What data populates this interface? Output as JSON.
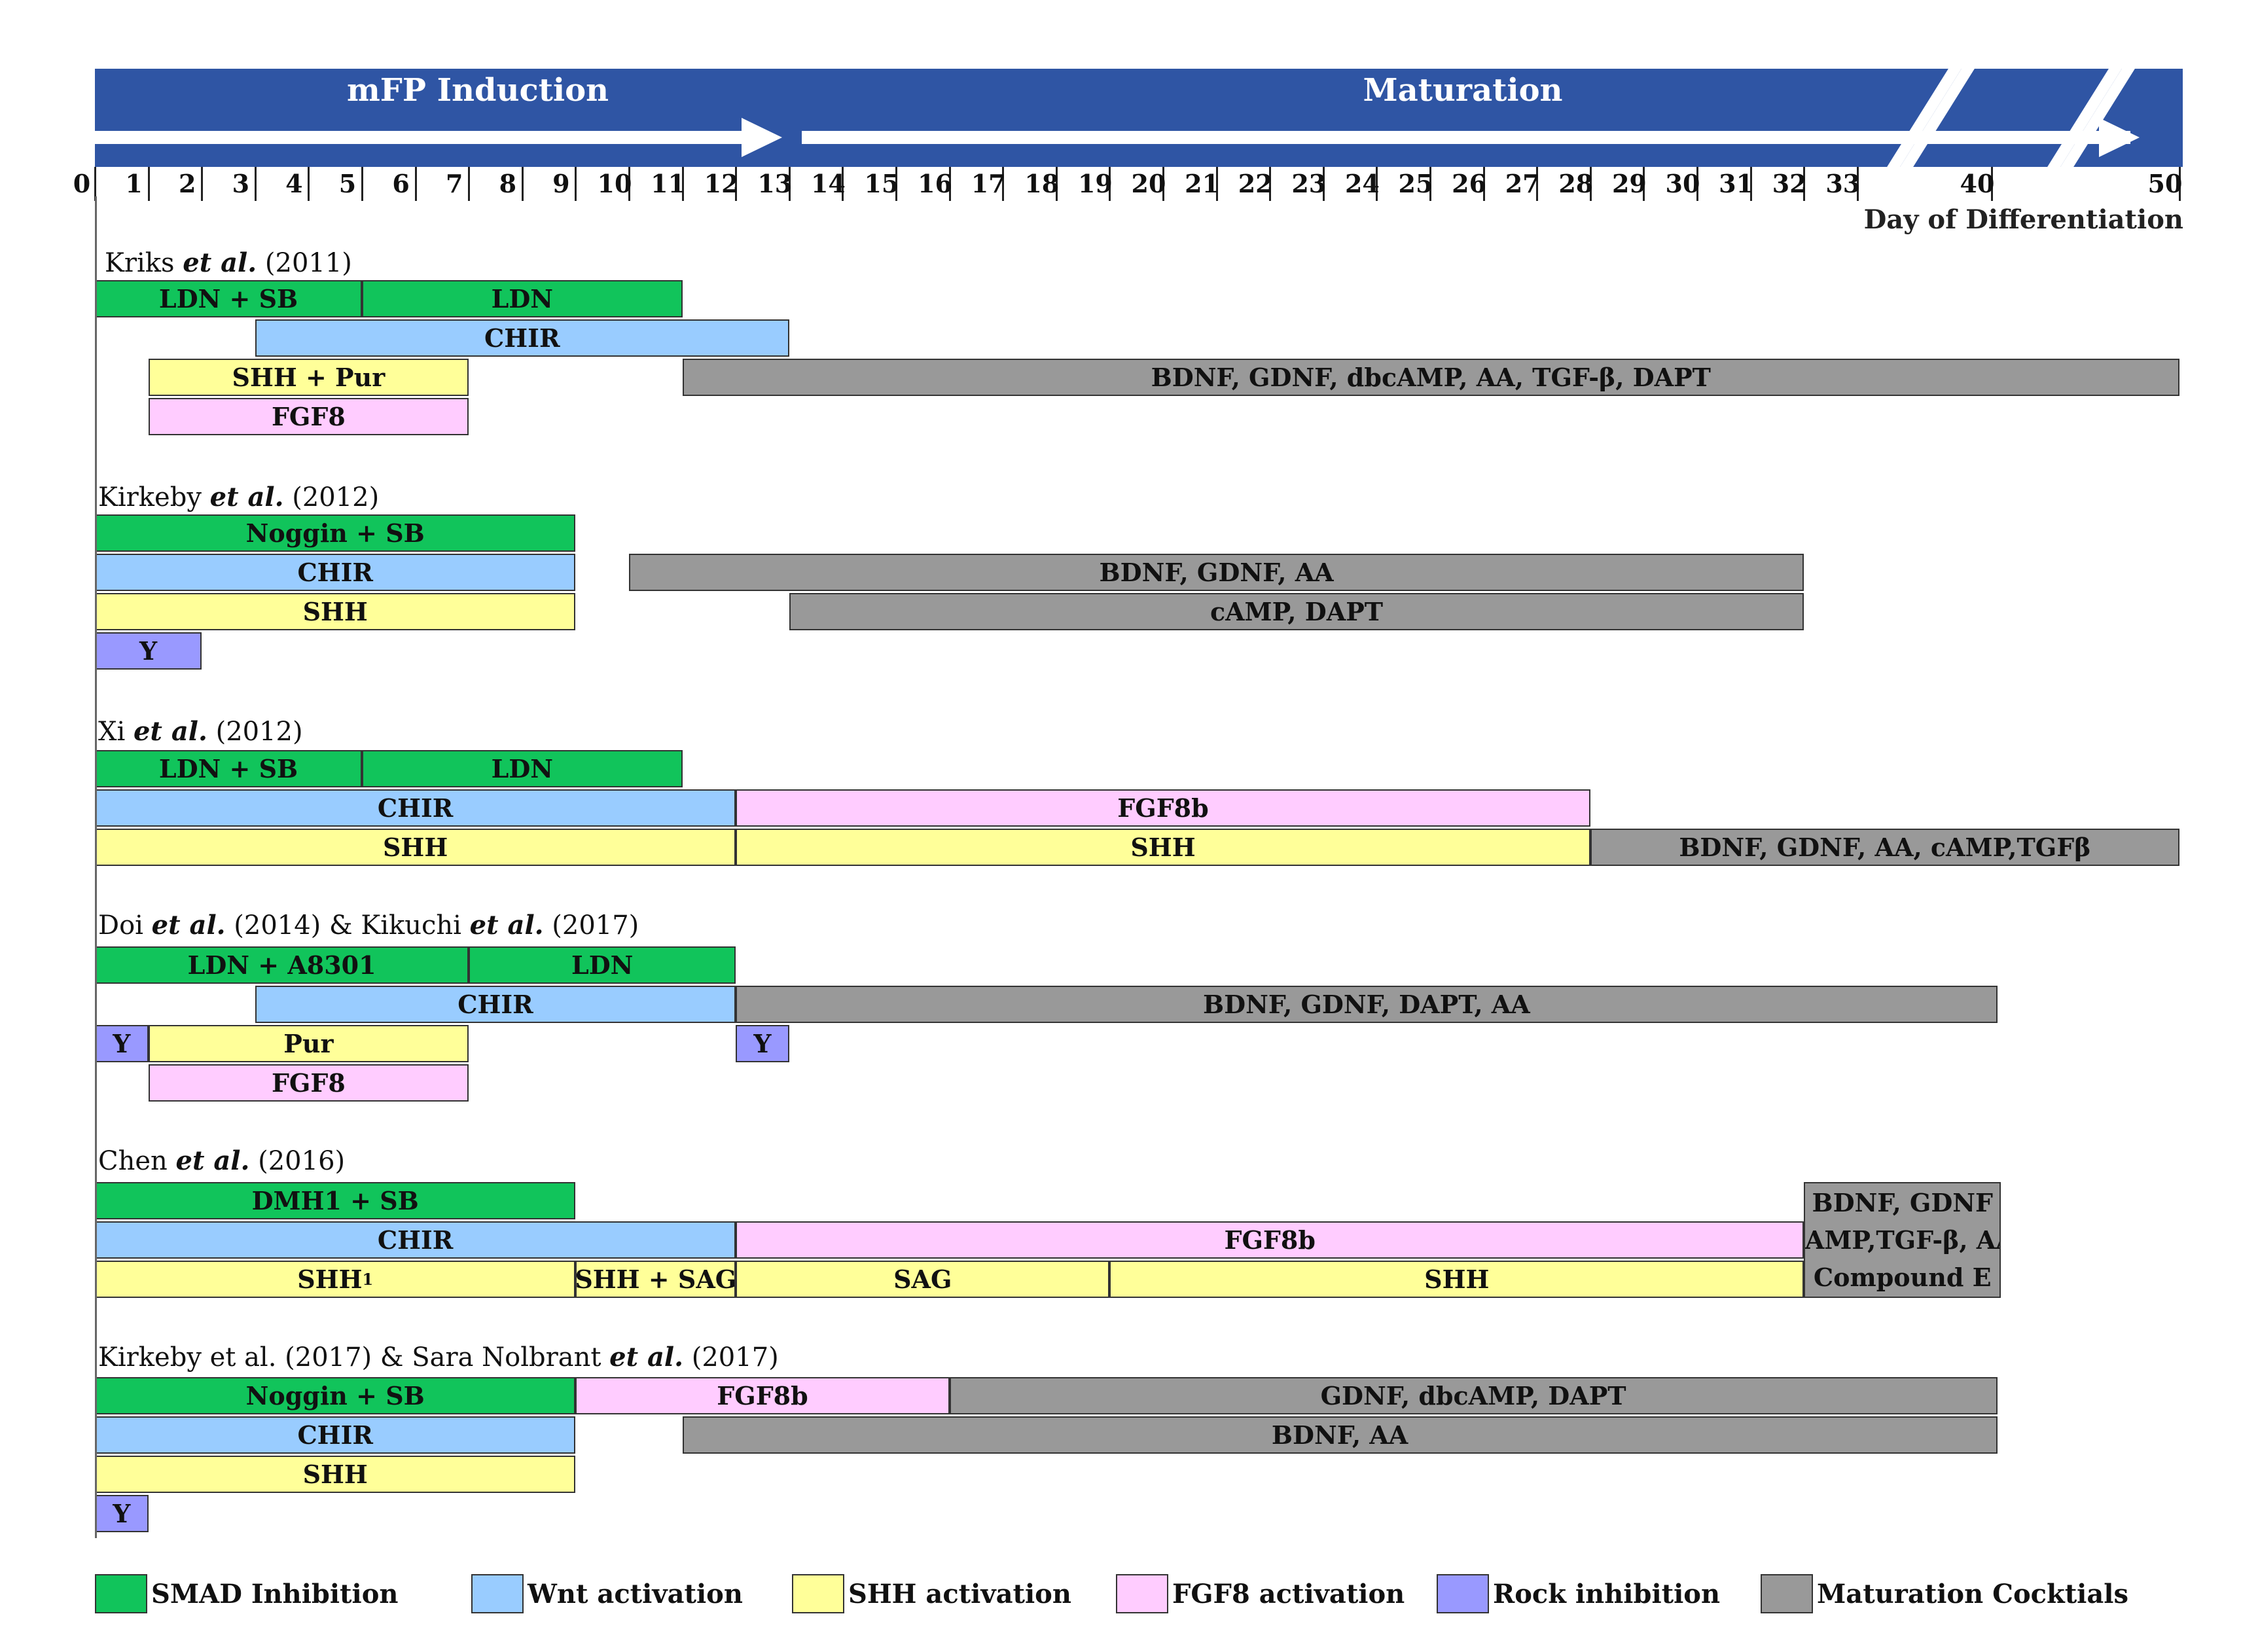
{
  "header": {
    "phases": [
      {
        "label": "mFP Induction",
        "from": 0,
        "to": 13
      },
      {
        "label": "Maturation",
        "from": 13,
        "to": 50
      }
    ],
    "axis_ticks": [
      "0",
      "1",
      "2",
      "3",
      "4",
      "5",
      "6",
      "7",
      "8",
      "9",
      "10",
      "11",
      "12",
      "13",
      "14",
      "15",
      "16",
      "17",
      "18",
      "19",
      "20",
      "21",
      "22",
      "23",
      "24",
      "25",
      "26",
      "27",
      "28",
      "29",
      "30",
      "31",
      "32",
      "33",
      "40",
      "50"
    ],
    "axis_title": "Day of Differentiation"
  },
  "colors": {
    "smad": "#11c45b",
    "wnt": "#99ccff",
    "shh": "#ffff99",
    "fgf8": "#ffccff",
    "rock": "#9999ff",
    "maturation": "#999999",
    "phase": "#2f55a4"
  },
  "studies": [
    {
      "title_parts": [
        {
          "t": "Kriks "
        },
        {
          "t": "et al.",
          "i": true
        },
        {
          "t": " (2011)"
        }
      ],
      "bars": [
        {
          "label": "LDN + SB",
          "row": 0,
          "from": 0,
          "to": 5,
          "type": "smad"
        },
        {
          "label": "LDN",
          "row": 0,
          "from": 5,
          "to": 11,
          "type": "smad"
        },
        {
          "label": "CHIR",
          "row": 1,
          "from": 3,
          "to": 13,
          "type": "wnt"
        },
        {
          "label": "SHH + Pur",
          "row": 2,
          "from": 1,
          "to": 7,
          "type": "shh"
        },
        {
          "label": "BDNF, GDNF, dbcAMP, AA, TGF-β, DAPT",
          "row": 2,
          "from": 11,
          "to": 50,
          "type": "maturation"
        },
        {
          "label": "FGF8",
          "row": 3,
          "from": 1,
          "to": 7,
          "type": "fgf8"
        }
      ]
    },
    {
      "title_parts": [
        {
          "t": "Kirkeby "
        },
        {
          "t": "et al.",
          "i": true
        },
        {
          "t": " (2012)"
        }
      ],
      "bars": [
        {
          "label": "Noggin + SB",
          "row": 0,
          "from": 0,
          "to": 9,
          "type": "smad"
        },
        {
          "label": "CHIR",
          "row": 1,
          "from": 0,
          "to": 9,
          "type": "wnt"
        },
        {
          "label": "BDNF, GDNF, AA",
          "row": 1,
          "from": 10,
          "to": 32,
          "type": "maturation"
        },
        {
          "label": "SHH",
          "row": 2,
          "from": 0,
          "to": 9,
          "type": "shh"
        },
        {
          "label": "cAMP, DAPT",
          "row": 2,
          "from": 13,
          "to": 32,
          "type": "maturation"
        },
        {
          "label": "Y",
          "row": 3,
          "from": 0,
          "to": 2,
          "type": "rock"
        }
      ]
    },
    {
      "title_parts": [
        {
          "t": "Xi "
        },
        {
          "t": "et al.",
          "i": true
        },
        {
          "t": " (2012)"
        }
      ],
      "bars": [
        {
          "label": "LDN + SB",
          "row": 0,
          "from": 0,
          "to": 5,
          "type": "smad"
        },
        {
          "label": "LDN",
          "row": 0,
          "from": 5,
          "to": 11,
          "type": "smad"
        },
        {
          "label": "CHIR",
          "row": 1,
          "from": 0,
          "to": 12,
          "type": "wnt"
        },
        {
          "label": "FGF8b",
          "row": 1,
          "from": 12,
          "to": 28,
          "type": "fgf8"
        },
        {
          "label": "SHH",
          "row": 2,
          "from": 0,
          "to": 12,
          "type": "shh"
        },
        {
          "label": "SHH",
          "row": 2,
          "from": 12,
          "to": 28,
          "type": "shh"
        },
        {
          "label": "BDNF, GDNF, AA, cAMP,TGFβ",
          "row": 2,
          "from": 28,
          "to": 50,
          "type": "maturation"
        }
      ]
    },
    {
      "title_parts": [
        {
          "t": "Doi "
        },
        {
          "t": "et al.",
          "i": true
        },
        {
          "t": " (2014) & Kikuchi "
        },
        {
          "t": "et al.",
          "i": true
        },
        {
          "t": " (2017)"
        }
      ],
      "bars": [
        {
          "label": "LDN + A8301",
          "row": 0,
          "from": 0,
          "to": 7,
          "type": "smad"
        },
        {
          "label": "LDN",
          "row": 0,
          "from": 7,
          "to": 12,
          "type": "smad"
        },
        {
          "label": "CHIR",
          "row": 1,
          "from": 3,
          "to": 12,
          "type": "wnt"
        },
        {
          "label": "BDNF, GDNF, DAPT, AA",
          "row": 1,
          "from": 12,
          "to": "40.3",
          "type": "maturation"
        },
        {
          "label": "Y",
          "row": 2,
          "from": 0,
          "to": 1,
          "type": "rock"
        },
        {
          "label": "Pur",
          "row": 2,
          "from": 1,
          "to": 7,
          "type": "shh"
        },
        {
          "label": "Y",
          "row": 2,
          "from": 12,
          "to": 13,
          "type": "rock"
        },
        {
          "label": "FGF8",
          "row": 3,
          "from": 1,
          "to": 7,
          "type": "fgf8"
        }
      ]
    },
    {
      "title_parts": [
        {
          "t": "Chen "
        },
        {
          "t": "et al.",
          "i": true
        },
        {
          "t": " (2016)"
        }
      ],
      "bars": [
        {
          "label": "DMH1 + SB",
          "row": 0,
          "from": 0,
          "to": 9,
          "type": "smad"
        },
        {
          "label": "CHIR",
          "row": 1,
          "from": 0,
          "to": 12,
          "type": "wnt"
        },
        {
          "label": "FGF8b",
          "row": 1,
          "from": 12,
          "to": 32,
          "type": "fgf8"
        },
        {
          "label": "SHH",
          "sup": "1",
          "row": 2,
          "from": 0,
          "to": 9,
          "type": "shh"
        },
        {
          "label": "SHH + SAG",
          "row": 2,
          "from": 9,
          "to": 12,
          "type": "shh"
        },
        {
          "label": "SAG",
          "row": 2,
          "from": 12,
          "to": 19,
          "type": "shh"
        },
        {
          "label": "SHH",
          "row": 2,
          "from": 19,
          "to": 32,
          "type": "shh"
        },
        {
          "lines": [
            "BDNF, GDNF",
            "cAMP,TGF-β, AA",
            "Compound E"
          ],
          "row": 0,
          "rows": 3,
          "from": 32,
          "to": "40.5",
          "type": "maturation"
        }
      ]
    },
    {
      "title_parts": [
        {
          "t": "Kirkeby et al. (2017) & Sara Nolbrant "
        },
        {
          "t": "et al.",
          "i": true
        },
        {
          "t": " (2017)"
        }
      ],
      "bars": [
        {
          "label": "Noggin + SB",
          "row": 0,
          "from": 0,
          "to": 9,
          "type": "smad"
        },
        {
          "label": "FGF8b",
          "row": 0,
          "from": 9,
          "to": 16,
          "type": "fgf8"
        },
        {
          "label": "GDNF, dbcAMP, DAPT",
          "row": 0,
          "from": 16,
          "to": "40.3",
          "type": "maturation"
        },
        {
          "label": "CHIR",
          "row": 1,
          "from": 0,
          "to": 9,
          "type": "wnt"
        },
        {
          "label": "BDNF, AA",
          "row": 1,
          "from": 11,
          "to": "40.3",
          "type": "maturation"
        },
        {
          "label": "SHH",
          "row": 2,
          "from": 0,
          "to": 9,
          "type": "shh"
        },
        {
          "label": "Y",
          "row": 3,
          "from": 0,
          "to": 1,
          "type": "rock"
        }
      ]
    }
  ],
  "legend": [
    {
      "type": "smad",
      "label": "SMAD Inhibition"
    },
    {
      "type": "wnt",
      "label": "Wnt activation"
    },
    {
      "type": "shh",
      "label": "SHH activation"
    },
    {
      "type": "fgf8",
      "label": "FGF8 activation"
    },
    {
      "type": "rock",
      "label": "Rock inhibition"
    },
    {
      "type": "maturation",
      "label": "Maturation Cocktials"
    }
  ]
}
